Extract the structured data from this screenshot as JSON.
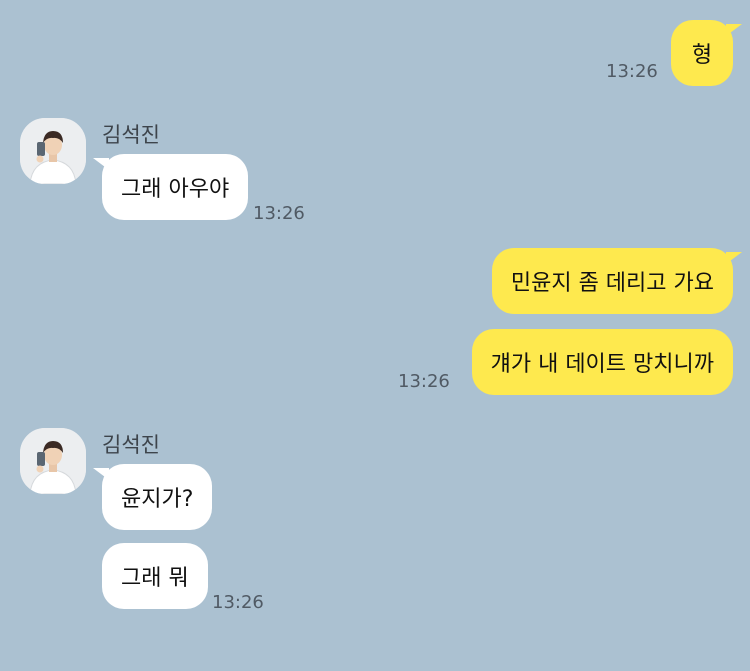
{
  "contact": {
    "name": "김석진"
  },
  "messages": [
    {
      "from": "me",
      "text": "형",
      "time": "13:26"
    },
    {
      "from": "them",
      "text": "그래 아우야",
      "time": "13:26"
    },
    {
      "from": "me",
      "text": "민윤지 좀 데리고 가요",
      "time": ""
    },
    {
      "from": "me",
      "text": "걔가 내 데이트 망치니까",
      "time": "13:26"
    },
    {
      "from": "them",
      "text": "윤지가?",
      "time": ""
    },
    {
      "from": "them",
      "text": "그래 뭐",
      "time": "13:26"
    }
  ],
  "colors": {
    "background": "#abc1d1",
    "my_bubble": "#fee94e",
    "their_bubble": "#ffffff"
  },
  "icons": {
    "avatar": "profile-photo-icon"
  }
}
